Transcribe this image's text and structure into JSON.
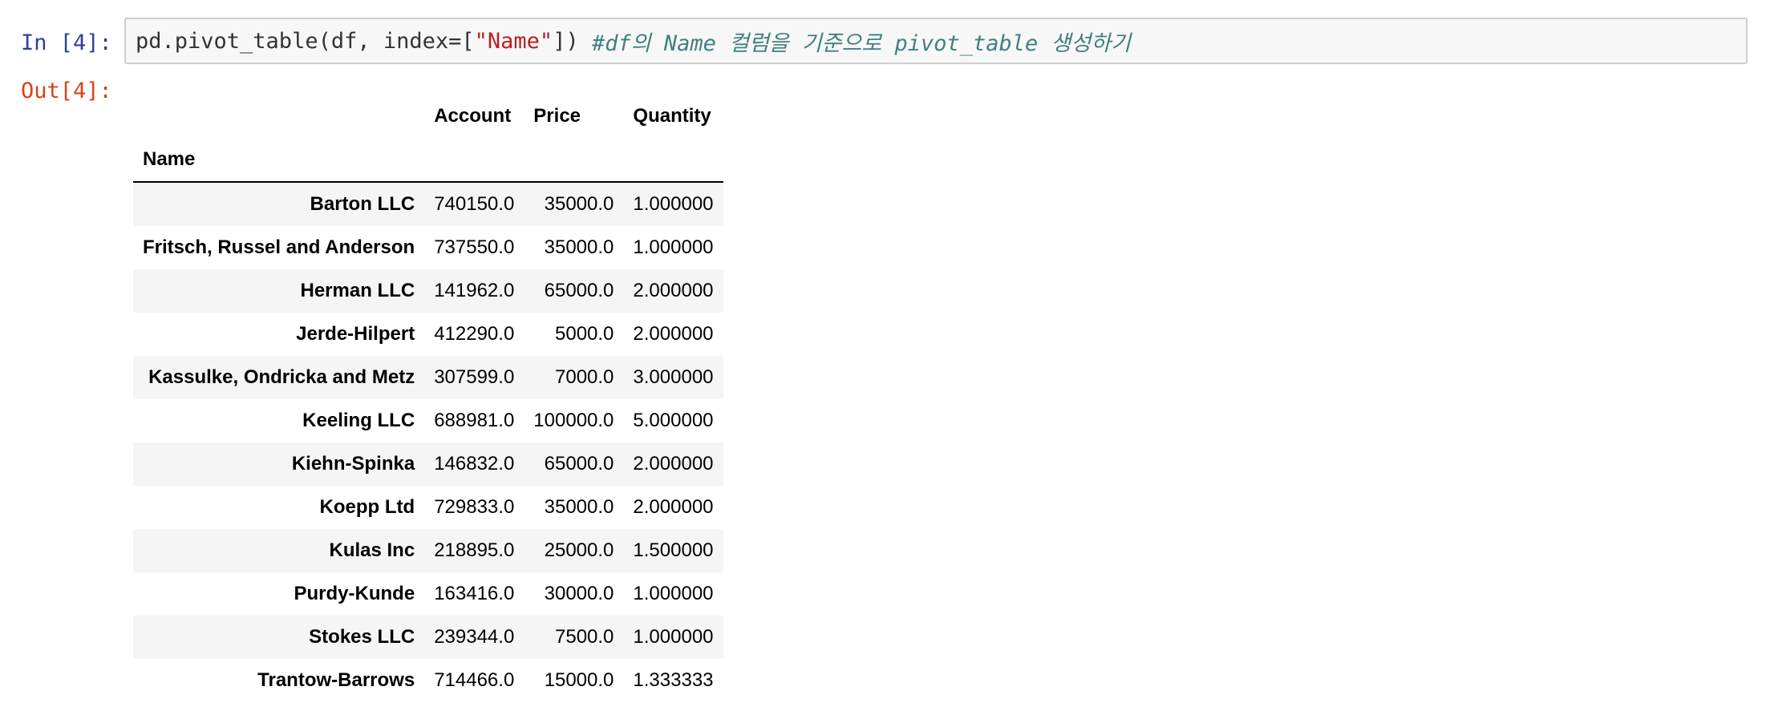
{
  "input_cell": {
    "prompt": "In [4]:",
    "code_prefix": "pd.pivot_table(df, index=[",
    "code_string": "\"Name\"",
    "code_suffix": "]) ",
    "code_comment": "#df의 Name 컬럼을 기준으로 pivot_table 생성하기"
  },
  "output_cell": {
    "prompt": "Out[4]:"
  },
  "table": {
    "columns": [
      "Account",
      "Price",
      "Quantity"
    ],
    "index_name": "Name",
    "rows": [
      {
        "name": "Barton LLC",
        "values": [
          "740150.0",
          "35000.0",
          "1.000000"
        ]
      },
      {
        "name": "Fritsch, Russel and Anderson",
        "values": [
          "737550.0",
          "35000.0",
          "1.000000"
        ]
      },
      {
        "name": "Herman LLC",
        "values": [
          "141962.0",
          "65000.0",
          "2.000000"
        ]
      },
      {
        "name": "Jerde-Hilpert",
        "values": [
          "412290.0",
          "5000.0",
          "2.000000"
        ]
      },
      {
        "name": "Kassulke, Ondricka and Metz",
        "values": [
          "307599.0",
          "7000.0",
          "3.000000"
        ]
      },
      {
        "name": "Keeling LLC",
        "values": [
          "688981.0",
          "100000.0",
          "5.000000"
        ]
      },
      {
        "name": "Kiehn-Spinka",
        "values": [
          "146832.0",
          "65000.0",
          "2.000000"
        ]
      },
      {
        "name": "Koepp Ltd",
        "values": [
          "729833.0",
          "35000.0",
          "2.000000"
        ]
      },
      {
        "name": "Kulas Inc",
        "values": [
          "218895.0",
          "25000.0",
          "1.500000"
        ]
      },
      {
        "name": "Purdy-Kunde",
        "values": [
          "163416.0",
          "30000.0",
          "1.000000"
        ]
      },
      {
        "name": "Stokes LLC",
        "values": [
          "239344.0",
          "7500.0",
          "1.000000"
        ]
      },
      {
        "name": "Trantow-Barrows",
        "values": [
          "714466.0",
          "15000.0",
          "1.333333"
        ]
      }
    ]
  }
}
